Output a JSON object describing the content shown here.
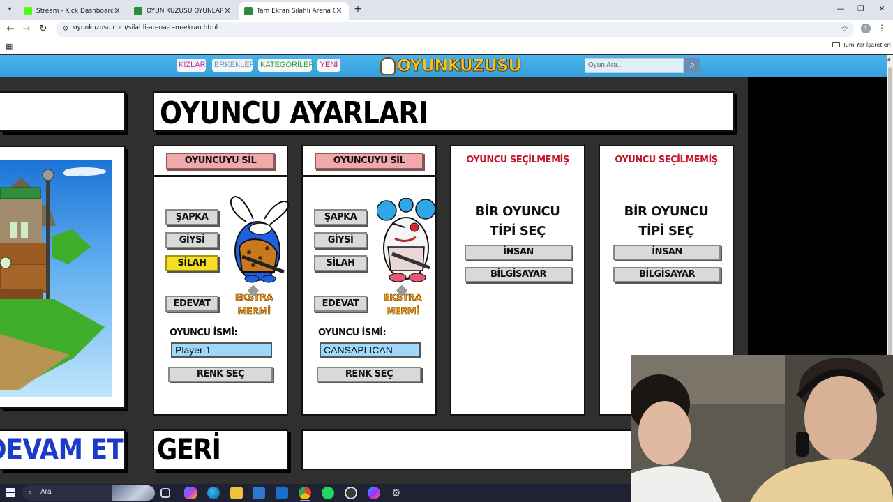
{
  "browser": {
    "tabs": [
      {
        "title": "Stream - Kick Dashboard",
        "favicon_color": "#53fc18",
        "active": false
      },
      {
        "title": "OYUN KUZUSU OYUNLAR ++",
        "favicon_color": "#2c8c3a",
        "active": false
      },
      {
        "title": "Tam Ekran Silahlı Arena Oyna",
        "favicon_color": "#2c8c3a",
        "active": true
      }
    ],
    "new_tab_symbol": "+",
    "url": "oyunkuzusu.com/silahli-arena-tam-ekran.html",
    "profile_initial": "Y",
    "bookmarks_folder": "Tüm Yer İşaretleri"
  },
  "site": {
    "nav": [
      {
        "label": "KIZLAR",
        "color": "#c02fb0"
      },
      {
        "label": "ERKEKLER",
        "color": "#5b9fd6"
      },
      {
        "label": "KATEGORİLER",
        "color": "#2fa34b"
      },
      {
        "label": "YENİ",
        "color": "#b01a8a"
      }
    ],
    "logo_text": "OYUNKUZUSU",
    "search_placeholder": "Oyun Ara.."
  },
  "game": {
    "title": "OYUNCU AYARLARI",
    "players": [
      {
        "delete_label": "OYUNCUYU SİL",
        "buttons": [
          "ŞAPKA",
          "GİYSİ",
          "SİLAH",
          "EDEVAT"
        ],
        "highlighted_button": "SİLAH",
        "extra_ammo": "EKSTRA MERMİ",
        "name_label": "OYUNCU İSMİ:",
        "name_value": "Player 1",
        "color_button": "RENK SEÇ",
        "character": "blue-rabbit"
      },
      {
        "delete_label": "OYUNCUYU SİL",
        "buttons": [
          "ŞAPKA",
          "GİYSİ",
          "SİLAH",
          "EDEVAT"
        ],
        "highlighted_button": "",
        "extra_ammo": "EKSTRA MERMİ",
        "name_label": "OYUNCU İSMİ:",
        "name_value": "CANSAPLICAN",
        "color_button": "RENK SEÇ",
        "character": "clown"
      }
    ],
    "empty_slots": [
      {
        "status": "OYUNCU SEÇİLMEMİŞ",
        "prompt": "BİR OYUNCU\nTİPİ SEÇ",
        "options": [
          "İNSAN",
          "BİLGİSAYAR"
        ]
      },
      {
        "status": "OYUNCU SEÇİLMEMİŞ",
        "prompt": "BİR OYUNCU\nTİPİ SEÇ",
        "options": [
          "İNSAN",
          "BİLGİSAYAR"
        ]
      }
    ],
    "continue_label": "DEVAM ET",
    "back_label": "GERİ"
  },
  "taskbar": {
    "search_label": "Ara",
    "apps": [
      "task-view-icon",
      "copilot-icon",
      "edge-icon",
      "file-explorer-icon",
      "store-icon",
      "mail-icon",
      "chrome-icon",
      "spotify-icon",
      "obs-icon",
      "messenger-icon",
      "settings-icon"
    ]
  }
}
